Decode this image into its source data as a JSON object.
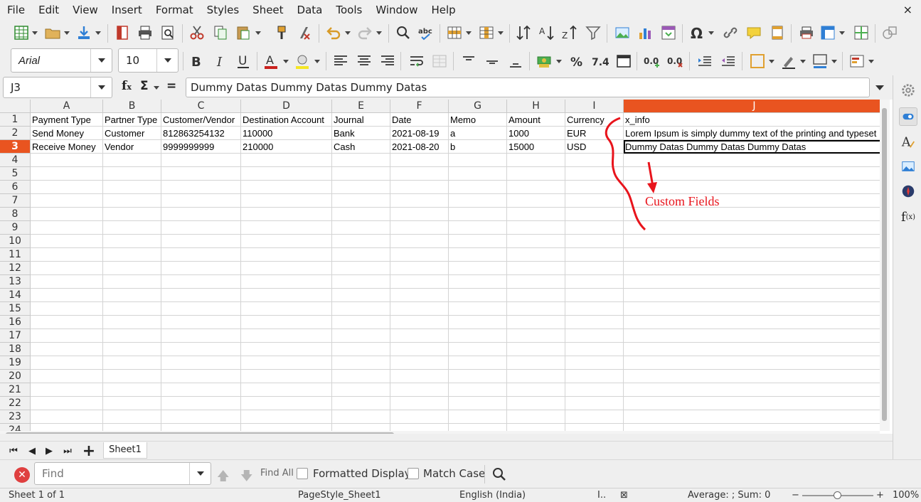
{
  "menu": [
    "File",
    "Edit",
    "View",
    "Insert",
    "Format",
    "Styles",
    "Sheet",
    "Data",
    "Tools",
    "Window",
    "Help"
  ],
  "window_close": "×",
  "font": {
    "name": "Arial",
    "size": "10"
  },
  "formula_bar": {
    "cell_ref": "J3",
    "content": "Dummy Datas Dummy Datas Dummy Datas",
    "sigma": "Σ",
    "equals": "="
  },
  "columns": [
    "A",
    "B",
    "C",
    "D",
    "E",
    "F",
    "G",
    "H",
    "I",
    "J"
  ],
  "selected_column": "J",
  "rows": [
    "1",
    "2",
    "3",
    "4",
    "5",
    "6",
    "7",
    "8",
    "9",
    "10",
    "11",
    "12",
    "13",
    "14",
    "15",
    "16",
    "17",
    "18",
    "19",
    "20",
    "21",
    "22",
    "23",
    "24"
  ],
  "selected_row": "3",
  "table": {
    "header": [
      "Payment Type",
      "Partner Type",
      "Customer/Vendor",
      "Destination Account",
      "Journal",
      "Date",
      "Memo",
      "Amount",
      "Currency",
      "x_info"
    ],
    "data": [
      [
        "Send Money",
        "Customer",
        "812863254132",
        "110000",
        "Bank",
        "2021-08-19",
        "a",
        "1000",
        "EUR",
        "Lorem Ipsum is simply dummy text of the printing and typeset"
      ],
      [
        "Receive Money",
        "Vendor",
        "9999999999",
        "210000",
        "Cash",
        "2021-08-20",
        "b",
        "15000",
        "USD",
        "Dummy Datas Dummy Datas Dummy Datas"
      ]
    ]
  },
  "annotation": {
    "label": "Custom Fields",
    "color": "#e8141c"
  },
  "sheet_tab": "Sheet1",
  "find_bar": {
    "placeholder": "Find",
    "find_all": "Find All",
    "formatted_display": "Formatted Display",
    "match_case": "Match Case"
  },
  "status": {
    "sheet": "Sheet 1 of 1",
    "page_style": "PageStyle_Sheet1",
    "language": "English (India)",
    "summary": "Average: ; Sum: 0",
    "zoom": "100%"
  },
  "colors": {
    "accent": "#e95420",
    "annotation": "#e8141c"
  }
}
